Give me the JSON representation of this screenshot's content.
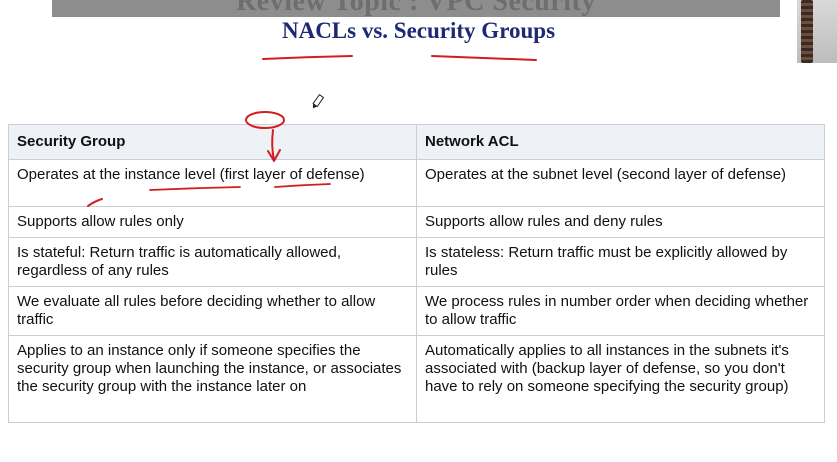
{
  "slide": {
    "banner_title": "Review Topic : VPC Security",
    "main_title": "NACLs vs. Security Groups"
  },
  "table": {
    "headers": [
      "Security Group",
      "Network ACL"
    ],
    "rows": [
      [
        "Operates at the instance level (first layer of defense)",
        "Operates at the subnet level (second layer of defense)"
      ],
      [
        "Supports allow rules only",
        "Supports allow rules and deny rules"
      ],
      [
        "Is stateful: Return traffic is automatically allowed, regardless of any rules",
        "Is stateless: Return traffic must be explicitly allowed by rules"
      ],
      [
        "We evaluate all rules before deciding whether to allow traffic",
        "We process rules in number order when deciding whether to allow traffic"
      ],
      [
        "Applies to an instance only if someone specifies the security group when launching the instance, or associates the security group with the instance later on",
        "Automatically applies to all instances in the subnets it's associated with (backup layer of defense, so you don't have to rely on someone specifying the security group)"
      ]
    ]
  },
  "colors": {
    "title": "#1d2a73",
    "header_bg": "#eef2f7",
    "border": "#c9cfd9",
    "annotation_ink": "#d21e1e"
  },
  "icons": [
    "pen-cursor-icon"
  ]
}
